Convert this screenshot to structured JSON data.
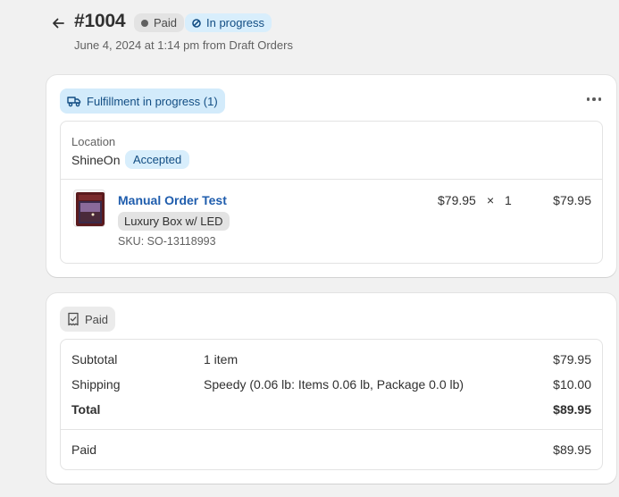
{
  "header": {
    "order_number": "#1004",
    "payment_badge": "Paid",
    "fulfillment_badge": "In progress",
    "subtitle": "June 4, 2024 at 1:14 pm from Draft Orders"
  },
  "fulfillment_card": {
    "status": "Fulfillment in progress (1)",
    "location_label": "Location",
    "location_name": "ShineOn",
    "location_status": "Accepted",
    "item": {
      "title": "Manual Order Test",
      "variant": "Luxury Box w/ LED",
      "sku": "SKU: SO-13118993",
      "unit_price": "$79.95",
      "times": "×",
      "quantity": "1",
      "total": "$79.95"
    }
  },
  "payment_card": {
    "status": "Paid",
    "rows": [
      {
        "label": "Subtotal",
        "detail": "1 item",
        "amount": "$79.95"
      },
      {
        "label": "Shipping",
        "detail": "Speedy (0.06 lb: Items 0.06 lb, Package 0.0 lb)",
        "amount": "$10.00"
      },
      {
        "label": "Total",
        "detail": "",
        "amount": "$89.95"
      }
    ],
    "paid": {
      "label": "Paid",
      "amount": "$89.95"
    }
  },
  "icons": {
    "back": "arrow-left-icon",
    "dot": "status-dot-icon",
    "progress": "in-progress-icon",
    "truck": "truck-icon",
    "more": "more-horizontal-icon",
    "receipt": "receipt-icon"
  },
  "colors": {
    "page_bg": "#f1f1f1",
    "link": "#1f5dad",
    "info_bg": "#d8eefc",
    "info_text": "#124d83"
  }
}
